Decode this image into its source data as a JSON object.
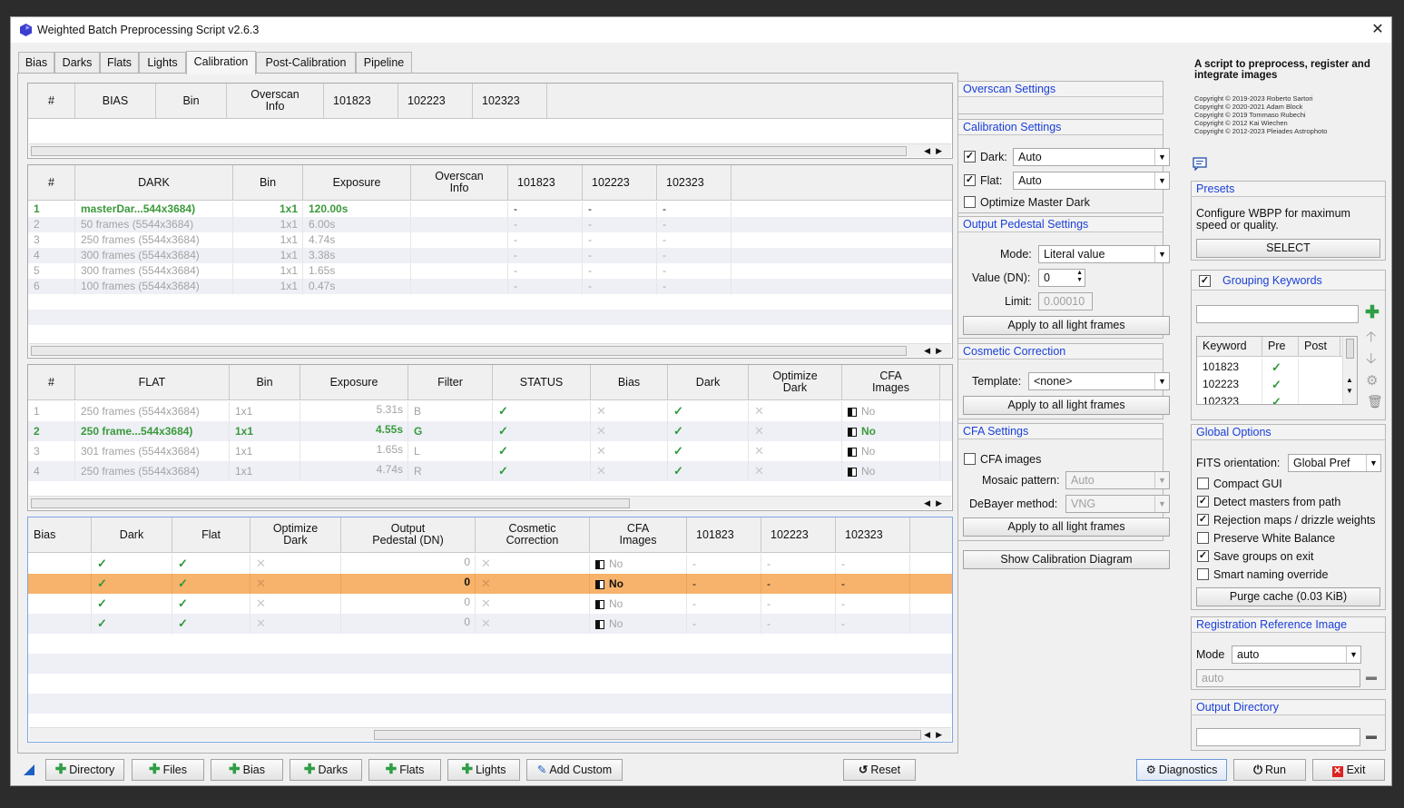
{
  "window": {
    "title": "Weighted Batch Preprocessing Script v2.6.3"
  },
  "tabs": [
    {
      "label": "Bias"
    },
    {
      "label": "Darks"
    },
    {
      "label": "Flats"
    },
    {
      "label": "Lights"
    },
    {
      "label": "Calibration"
    },
    {
      "label": "Post-Calibration"
    },
    {
      "label": "Pipeline"
    }
  ],
  "bias_table": {
    "headers": [
      "#",
      "BIAS",
      "Bin",
      "Overscan\nInfo",
      "101823",
      "102223",
      "102323"
    ]
  },
  "dark_table": {
    "headers": [
      "#",
      "DARK",
      "Bin",
      "Exposure",
      "Overscan\nInfo",
      "101823",
      "102223",
      "102323"
    ],
    "rows": [
      {
        "n": "1",
        "name": "masterDar...544x3684)",
        "bin": "1x1",
        "exp": "120.00s",
        "k1": "-",
        "k2": "-",
        "k3": "-"
      },
      {
        "n": "2",
        "name": "50 frames (5544x3684)",
        "bin": "1x1",
        "exp": "6.00s",
        "k1": "-",
        "k2": "-",
        "k3": "-"
      },
      {
        "n": "3",
        "name": "250 frames (5544x3684)",
        "bin": "1x1",
        "exp": "4.74s",
        "k1": "-",
        "k2": "-",
        "k3": "-"
      },
      {
        "n": "4",
        "name": "300 frames (5544x3684)",
        "bin": "1x1",
        "exp": "3.38s",
        "k1": "-",
        "k2": "-",
        "k3": "-"
      },
      {
        "n": "5",
        "name": "300 frames (5544x3684)",
        "bin": "1x1",
        "exp": "1.65s",
        "k1": "-",
        "k2": "-",
        "k3": "-"
      },
      {
        "n": "6",
        "name": "100 frames (5544x3684)",
        "bin": "1x1",
        "exp": "0.47s",
        "k1": "-",
        "k2": "-",
        "k3": "-"
      }
    ]
  },
  "flat_table": {
    "headers": [
      "#",
      "FLAT",
      "Bin",
      "Exposure",
      "Filter",
      "STATUS",
      "Bias",
      "Dark",
      "Optimize\nDark",
      "CFA\nImages"
    ],
    "rows": [
      {
        "n": "1",
        "name": "250 frames (5544x3684)",
        "bin": "1x1",
        "exp": "5.31s",
        "filter": "B",
        "cfa": "No"
      },
      {
        "n": "2",
        "name": "250 frame...544x3684)",
        "bin": "1x1",
        "exp": "4.55s",
        "filter": "G",
        "cfa": "No"
      },
      {
        "n": "3",
        "name": "301 frames (5544x3684)",
        "bin": "1x1",
        "exp": "1.65s",
        "filter": "L",
        "cfa": "No"
      },
      {
        "n": "4",
        "name": "250 frames (5544x3684)",
        "bin": "1x1",
        "exp": "4.74s",
        "filter": "R",
        "cfa": "No"
      }
    ]
  },
  "light_table": {
    "headers": [
      "Bias",
      "Dark",
      "Flat",
      "Optimize\nDark",
      "Output\nPedestal (DN)",
      "Cosmetic\nCorrection",
      "CFA\nImages",
      "101823",
      "102223",
      "102323"
    ],
    "rows": [
      {
        "ped": "0",
        "cfa": "No",
        "k1": "-",
        "k2": "-",
        "k3": "-"
      },
      {
        "ped": "0",
        "cfa": "No",
        "k1": "-",
        "k2": "-",
        "k3": "-"
      },
      {
        "ped": "0",
        "cfa": "No",
        "k1": "-",
        "k2": "-",
        "k3": "-"
      },
      {
        "ped": "0",
        "cfa": "No",
        "k1": "-",
        "k2": "-",
        "k3": "-"
      }
    ]
  },
  "overscan": {
    "title": "Overscan Settings"
  },
  "calibration_settings": {
    "title": "Calibration Settings",
    "dark_label": "Dark:",
    "dark_value": "Auto",
    "flat_label": "Flat:",
    "flat_value": "Auto",
    "optimize_label": "Optimize Master Dark"
  },
  "pedestal": {
    "title": "Output Pedestal Settings",
    "mode_label": "Mode:",
    "mode_value": "Literal value",
    "value_label": "Value (DN):",
    "value": "0",
    "limit_label": "Limit:",
    "limit": "0.00010",
    "apply": "Apply to all light frames"
  },
  "cosmetic": {
    "title": "Cosmetic Correction",
    "template_label": "Template:",
    "template_value": "<none>",
    "apply": "Apply to all light frames"
  },
  "cfa": {
    "title": "CFA Settings",
    "cfa_label": "CFA images",
    "mosaic_label": "Mosaic pattern:",
    "mosaic_value": "Auto",
    "debayer_label": "DeBayer method:",
    "debayer_value": "VNG",
    "apply": "Apply to all light frames"
  },
  "show_diagram": "Show Calibration Diagram",
  "about": {
    "heading": "A script to preprocess, register and integrate images",
    "copyright": [
      "Copyright © 2019-2023 Roberto Sartori",
      "Copyright © 2020-2021 Adam Block",
      "Copyright © 2019 Tommaso Rubechi",
      "Copyright © 2012 Kai Wiechen",
      "Copyright © 2012-2023 Pleiades Astrophoto"
    ]
  },
  "presets": {
    "title": "Presets",
    "text": "Configure WBPP for maximum speed or quality.",
    "button": "SELECT"
  },
  "grouping": {
    "title": "Grouping Keywords",
    "headers": [
      "Keyword",
      "Pre",
      "Post"
    ],
    "rows": [
      {
        "keyword": "101823"
      },
      {
        "keyword": "102223"
      },
      {
        "keyword": "102323"
      }
    ]
  },
  "global_options": {
    "title": "Global Options",
    "fits_label": "FITS orientation:",
    "fits_value": "Global Pref",
    "options": [
      {
        "label": "Compact GUI",
        "checked": false
      },
      {
        "label": "Detect masters from path",
        "checked": true
      },
      {
        "label": "Rejection maps / drizzle weights",
        "checked": true
      },
      {
        "label": "Preserve White Balance",
        "checked": false
      },
      {
        "label": "Save groups on exit",
        "checked": true
      },
      {
        "label": "Smart naming override",
        "checked": false
      }
    ],
    "purge": "Purge cache (0.03 KiB)"
  },
  "registration": {
    "title": "Registration Reference Image",
    "mode_label": "Mode",
    "mode_value": "auto",
    "path_value": "auto"
  },
  "output_dir": {
    "title": "Output Directory"
  },
  "bottom": {
    "directory": "Directory",
    "files": "Files",
    "bias": "Bias",
    "darks": "Darks",
    "flats": "Flats",
    "lights": "Lights",
    "add_custom": "Add Custom",
    "reset": "Reset",
    "diagnostics": "Diagnostics",
    "run": "Run",
    "exit": "Exit"
  },
  "colors": {
    "accent": "#1a3fd8",
    "selected_row": "#f7b26b",
    "green": "#3a9a3a"
  }
}
